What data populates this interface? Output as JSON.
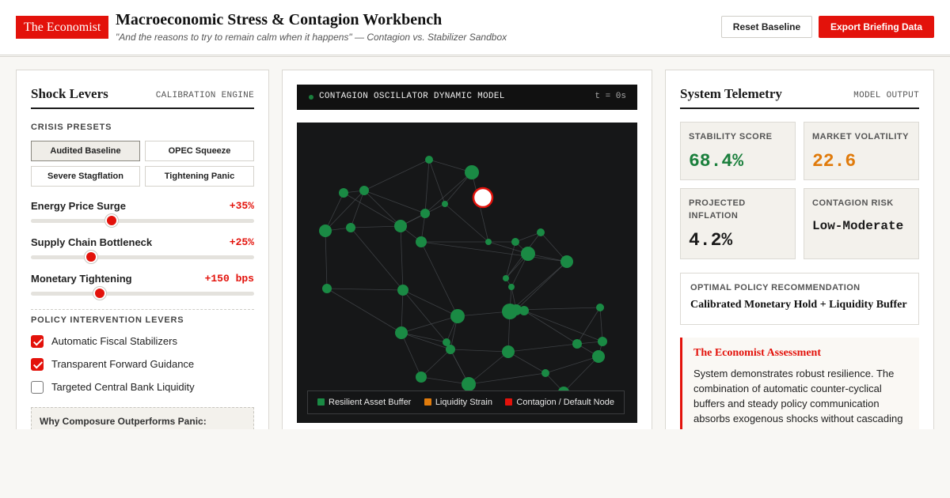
{
  "header": {
    "brand": "The Economist",
    "title": "Macroeconomic Stress & Contagion Workbench",
    "subtitle": "\"And the reasons to try to remain calm when it happens\" — Contagion vs. Stabilizer Sandbox",
    "reset_label": "Reset Baseline",
    "export_label": "Export Briefing Data"
  },
  "shock": {
    "title": "Shock Levers",
    "tag": "CALIBRATION ENGINE",
    "presets_label": "CRISIS PRESETS",
    "presets": [
      {
        "label": "Audited Baseline",
        "active": true
      },
      {
        "label": "OPEC Squeeze",
        "active": false
      },
      {
        "label": "Severe Stagflation",
        "active": false
      },
      {
        "label": "Tightening Panic",
        "active": false
      }
    ],
    "sliders": [
      {
        "label": "Energy Price Surge",
        "value": "+35%",
        "level": 0.36
      },
      {
        "label": "Supply Chain Bottleneck",
        "value": "+25%",
        "level": 0.27
      },
      {
        "label": "Monetary Tightening",
        "value": "+150 bps",
        "level": 0.31
      }
    ],
    "policy_label": "POLICY INTERVENTION LEVERS",
    "policies": [
      {
        "label": "Automatic Fiscal Stabilizers",
        "checked": true
      },
      {
        "label": "Transparent Forward Guidance",
        "checked": true
      },
      {
        "label": "Targeted Central Bank Liquidity",
        "checked": false
      }
    ],
    "why_label": "Why Composure Outperforms Panic:"
  },
  "oscillator": {
    "title": "CONTAGION OSCILLATOR DYNAMIC MODEL",
    "time": "t = 0s",
    "legend": [
      {
        "label": "Resilient Asset Buffer",
        "color": "#1a8a44"
      },
      {
        "label": "Liquidity Strain",
        "color": "#e07b0c"
      },
      {
        "label": "Contagion / Default Node",
        "color": "#e3120b"
      }
    ]
  },
  "telemetry": {
    "title": "System Telemetry",
    "tag": "MODEL OUTPUT",
    "metrics": [
      {
        "label": "STABILITY SCORE",
        "value": "68.4%",
        "color": "#1a7f3c"
      },
      {
        "label": "MARKET VOLATILITY",
        "value": "22.6",
        "color": "#e07b0c"
      },
      {
        "label": "PROJECTED INFLATION",
        "value": "4.2%",
        "color": "#1a1a1a"
      },
      {
        "label": "CONTAGION RISK",
        "value": "Low-Moderate",
        "color": "#1a1a1a"
      }
    ],
    "policy_rec_label": "OPTIMAL POLICY RECOMMENDATION",
    "policy_rec_value": "Calibrated Monetary Hold + Liquidity Buffer",
    "assessment_title": "The Economist Assessment",
    "assessment_body": "System demonstrates robust resilience. The combination of automatic counter-cyclical buffers and steady policy communication absorbs exogenous shocks without cascading"
  }
}
